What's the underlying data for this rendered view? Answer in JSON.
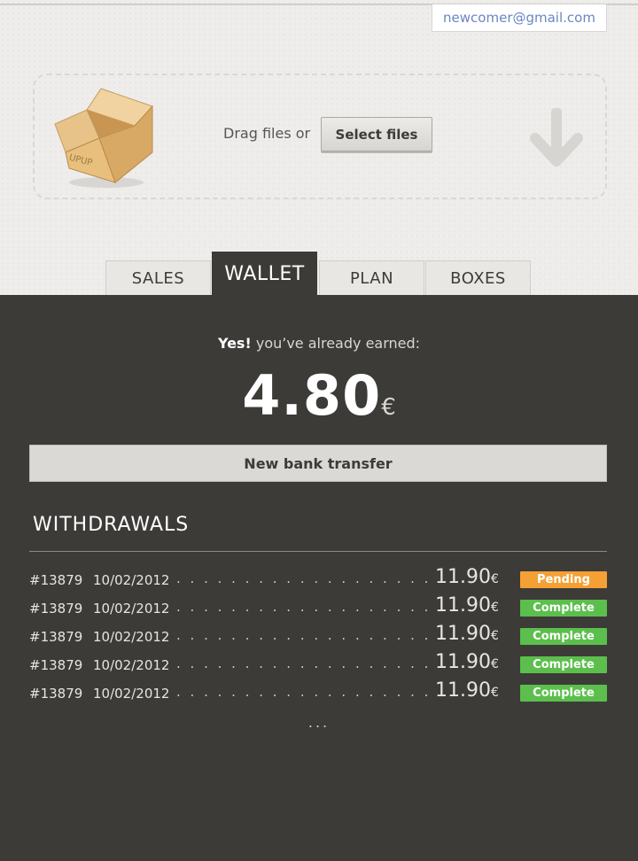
{
  "header": {
    "email": "newcomer@gmail.com"
  },
  "upload": {
    "box_label": "UPUP",
    "drag_text": "Drag files or",
    "select_label": "Select files"
  },
  "tabs": [
    {
      "label": "SALES",
      "active": false
    },
    {
      "label": "WALLET",
      "active": true
    },
    {
      "label": "PLAN",
      "active": false
    },
    {
      "label": "BOXES",
      "active": false
    }
  ],
  "wallet": {
    "earned_prefix": "Yes!",
    "earned_suffix": "you’ve already earned:",
    "amount": "4.80",
    "currency": "€",
    "transfer_label": "New bank transfer"
  },
  "withdrawals": {
    "title": "WITHDRAWALS",
    "rows": [
      {
        "id": "#13879",
        "date": "10/02/2012",
        "amount": "11.90",
        "currency": "€",
        "status": "Pending",
        "status_color": "#f5a035"
      },
      {
        "id": "#13879",
        "date": "10/02/2012",
        "amount": "11.90",
        "currency": "€",
        "status": "Complete",
        "status_color": "#5cbf4d"
      },
      {
        "id": "#13879",
        "date": "10/02/2012",
        "amount": "11.90",
        "currency": "€",
        "status": "Complete",
        "status_color": "#5cbf4d"
      },
      {
        "id": "#13879",
        "date": "10/02/2012",
        "amount": "11.90",
        "currency": "€",
        "status": "Complete",
        "status_color": "#5cbf4d"
      },
      {
        "id": "#13879",
        "date": "10/02/2012",
        "amount": "11.90",
        "currency": "€",
        "status": "Complete",
        "status_color": "#5cbf4d"
      }
    ],
    "more": "..."
  },
  "icons": {
    "box": "open-cardboard-box-icon",
    "arrow": "arrow-down-icon"
  }
}
